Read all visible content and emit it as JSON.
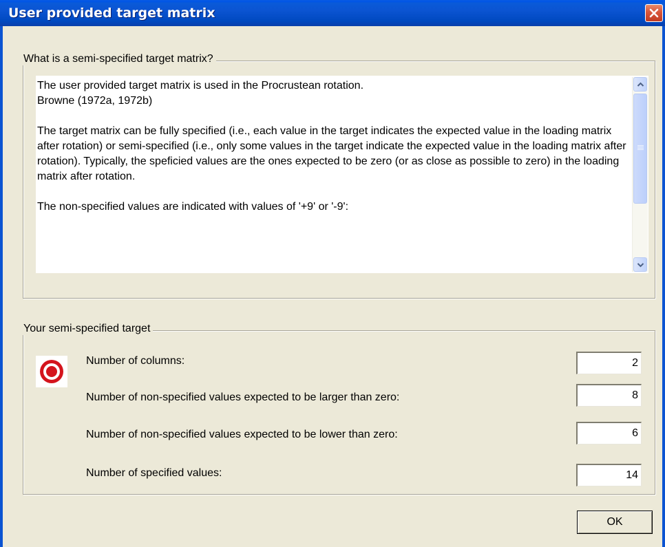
{
  "window": {
    "title": "User provided target matrix",
    "close_icon": "close-icon"
  },
  "info_group": {
    "legend": "What is a semi-specified target matrix?",
    "paragraphs": [
      "The user provided target matrix is used in the Procrustean rotation.",
      "Browne (1972a, 1972b)",
      "The target matrix can be fully specified (i.e., each value in the target indicates the expected value in the loading matrix after rotation) or semi-specified (i.e., only some values in the target indicate the expected value in the loading matrix after rotation). Typically, the speficied values are the ones expected to be zero (or as close as possible to zero) in the loading matrix after rotation.",
      "The non-specified values are indicated with values of '+9' or '-9':"
    ]
  },
  "target_group": {
    "legend": "Your semi-specified target",
    "icon": "target-icon",
    "rows": [
      {
        "label": "Number of columns:",
        "value": "2"
      },
      {
        "label": "Number of non-specified values expected to be larger than zero:",
        "value": "8"
      },
      {
        "label": "Number of non-specified values expected to be lower than zero:",
        "value": "6"
      },
      {
        "label": "Number of specified values:",
        "value": "14"
      }
    ]
  },
  "buttons": {
    "ok_label": "OK"
  },
  "colors": {
    "titlebar": "#0b54d2",
    "dialog_bg": "#ece9d8",
    "close_button": "#d8553a",
    "target_red": "#d4141c"
  }
}
